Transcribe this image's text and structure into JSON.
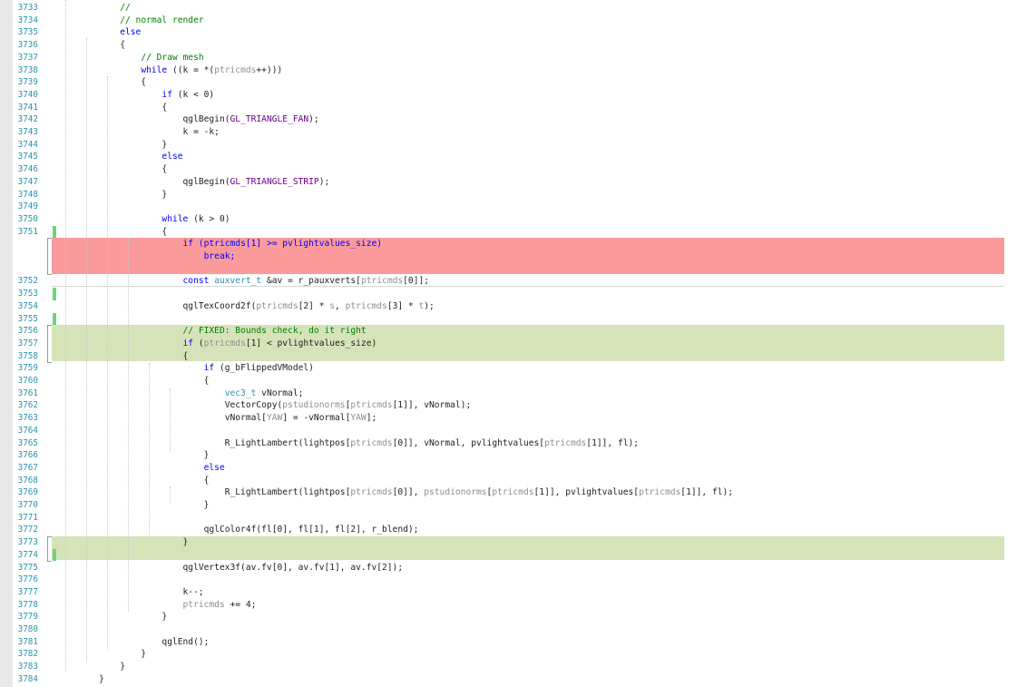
{
  "colors": {
    "line_number": "#2b91af",
    "keyword": "#0000ff",
    "comment": "#008000",
    "type": "#2b91af",
    "removed_block": "#fa9a9a",
    "added_block": "#d6e3b9",
    "change_marker": "#6bd67a"
  },
  "lines": [
    {
      "num": "3733",
      "tokens": [
        {
          "t": "        "
        },
        {
          "t": "//",
          "c": "cm"
        }
      ]
    },
    {
      "num": "3734",
      "tokens": [
        {
          "t": "        "
        },
        {
          "t": "// normal render",
          "c": "cm"
        }
      ]
    },
    {
      "num": "3735",
      "tokens": [
        {
          "t": "        "
        },
        {
          "t": "else",
          "c": "kw"
        }
      ]
    },
    {
      "num": "3736",
      "tokens": [
        {
          "t": "        {"
        }
      ]
    },
    {
      "num": "3737",
      "tokens": [
        {
          "t": "            "
        },
        {
          "t": "// Draw mesh",
          "c": "cm"
        }
      ]
    },
    {
      "num": "3738",
      "tokens": [
        {
          "t": "            "
        },
        {
          "t": "while",
          "c": "kw"
        },
        {
          "t": " ((k = *("
        },
        {
          "t": "ptricmds",
          "c": "ga"
        },
        {
          "t": "++)))"
        }
      ]
    },
    {
      "num": "3739",
      "tokens": [
        {
          "t": "            {"
        }
      ]
    },
    {
      "num": "3740",
      "tokens": [
        {
          "t": "                "
        },
        {
          "t": "if",
          "c": "kw"
        },
        {
          "t": " (k < 0)"
        }
      ]
    },
    {
      "num": "3741",
      "tokens": [
        {
          "t": "                {"
        }
      ]
    },
    {
      "num": "3742",
      "tokens": [
        {
          "t": "                    qglBegin("
        },
        {
          "t": "GL_TRIANGLE_FAN",
          "c": "mac"
        },
        {
          "t": ");"
        }
      ]
    },
    {
      "num": "3743",
      "tokens": [
        {
          "t": "                    k = -k;"
        }
      ]
    },
    {
      "num": "3744",
      "tokens": [
        {
          "t": "                }"
        }
      ]
    },
    {
      "num": "3745",
      "tokens": [
        {
          "t": "                "
        },
        {
          "t": "else",
          "c": "kw"
        }
      ]
    },
    {
      "num": "3746",
      "tokens": [
        {
          "t": "                {"
        }
      ]
    },
    {
      "num": "3747",
      "tokens": [
        {
          "t": "                    qglBegin("
        },
        {
          "t": "GL_TRIANGLE_STRIP",
          "c": "mac"
        },
        {
          "t": ");"
        }
      ]
    },
    {
      "num": "3748",
      "tokens": [
        {
          "t": "                }"
        }
      ]
    },
    {
      "num": "3749",
      "tokens": [
        {
          "t": ""
        }
      ]
    },
    {
      "num": "3750",
      "tokens": [
        {
          "t": "                "
        },
        {
          "t": "while",
          "c": "kw"
        },
        {
          "t": " (k > 0)"
        }
      ]
    },
    {
      "num": "3751",
      "tokens": [
        {
          "t": "                {"
        }
      ]
    },
    {
      "num": "",
      "tokens": [
        {
          "t": "                    "
        },
        {
          "t": "if (ptricmds[1] >= pvlightvalues_size)",
          "c": "kw"
        }
      ]
    },
    {
      "num": "",
      "tokens": [
        {
          "t": "                        "
        },
        {
          "t": "break;",
          "c": "kw"
        }
      ]
    },
    {
      "num": "",
      "tokens": [
        {
          "t": ""
        }
      ]
    },
    {
      "num": "3752",
      "tokens": [
        {
          "t": "                    "
        },
        {
          "t": "const",
          "c": "kw"
        },
        {
          "t": " "
        },
        {
          "t": "auxvert_t",
          "c": "ty"
        },
        {
          "t": " &av = r_pauxverts["
        },
        {
          "t": "ptricmds",
          "c": "ga"
        },
        {
          "t": "[0]];"
        }
      ]
    },
    {
      "num": "3753",
      "tokens": [
        {
          "t": ""
        }
      ]
    },
    {
      "num": "3754",
      "tokens": [
        {
          "t": "                    qglTexCoord2f("
        },
        {
          "t": "ptricmds",
          "c": "ga"
        },
        {
          "t": "[2] * "
        },
        {
          "t": "s",
          "c": "ga"
        },
        {
          "t": ", "
        },
        {
          "t": "ptricmds",
          "c": "ga"
        },
        {
          "t": "[3] * "
        },
        {
          "t": "t",
          "c": "ga"
        },
        {
          "t": ");"
        }
      ]
    },
    {
      "num": "3755",
      "tokens": [
        {
          "t": ""
        }
      ]
    },
    {
      "num": "3756",
      "tokens": [
        {
          "t": "                    "
        },
        {
          "t": "// FIXED: Bounds check, do it right",
          "c": "cm"
        }
      ]
    },
    {
      "num": "3757",
      "tokens": [
        {
          "t": "                    "
        },
        {
          "t": "if",
          "c": "kw"
        },
        {
          "t": " ("
        },
        {
          "t": "ptricmds",
          "c": "ga"
        },
        {
          "t": "[1] < pvlightvalues_size)"
        }
      ]
    },
    {
      "num": "3758",
      "tokens": [
        {
          "t": "                    {"
        }
      ]
    },
    {
      "num": "3759",
      "tokens": [
        {
          "t": "                        "
        },
        {
          "t": "if",
          "c": "kw"
        },
        {
          "t": " (g_bFlippedVModel)"
        }
      ]
    },
    {
      "num": "3760",
      "tokens": [
        {
          "t": "                        {"
        }
      ]
    },
    {
      "num": "3761",
      "tokens": [
        {
          "t": "                            "
        },
        {
          "t": "vec3_t",
          "c": "ty"
        },
        {
          "t": " vNormal;"
        }
      ]
    },
    {
      "num": "3762",
      "tokens": [
        {
          "t": "                            VectorCopy("
        },
        {
          "t": "pstudionorms",
          "c": "ga"
        },
        {
          "t": "["
        },
        {
          "t": "ptricmds",
          "c": "ga"
        },
        {
          "t": "[1]], vNormal);"
        }
      ]
    },
    {
      "num": "3763",
      "tokens": [
        {
          "t": "                            vNormal["
        },
        {
          "t": "YAW",
          "c": "ga"
        },
        {
          "t": "] = -vNormal["
        },
        {
          "t": "YAW",
          "c": "ga"
        },
        {
          "t": "];"
        }
      ]
    },
    {
      "num": "3764",
      "tokens": [
        {
          "t": ""
        }
      ]
    },
    {
      "num": "3765",
      "tokens": [
        {
          "t": "                            R_LightLambert(lightpos["
        },
        {
          "t": "ptricmds",
          "c": "ga"
        },
        {
          "t": "[0]], vNormal, pvlightvalues["
        },
        {
          "t": "ptricmds",
          "c": "ga"
        },
        {
          "t": "[1]], fl);"
        }
      ]
    },
    {
      "num": "3766",
      "tokens": [
        {
          "t": "                        }"
        }
      ]
    },
    {
      "num": "3767",
      "tokens": [
        {
          "t": "                        "
        },
        {
          "t": "else",
          "c": "kw"
        }
      ]
    },
    {
      "num": "3768",
      "tokens": [
        {
          "t": "                        {"
        }
      ]
    },
    {
      "num": "3769",
      "tokens": [
        {
          "t": "                            R_LightLambert(lightpos["
        },
        {
          "t": "ptricmds",
          "c": "ga"
        },
        {
          "t": "[0]], "
        },
        {
          "t": "pstudionorms",
          "c": "ga"
        },
        {
          "t": "["
        },
        {
          "t": "ptricmds",
          "c": "ga"
        },
        {
          "t": "[1]], pvlightvalues["
        },
        {
          "t": "ptricmds",
          "c": "ga"
        },
        {
          "t": "[1]], fl);"
        }
      ]
    },
    {
      "num": "3770",
      "tokens": [
        {
          "t": "                        }"
        }
      ]
    },
    {
      "num": "3771",
      "tokens": [
        {
          "t": ""
        }
      ]
    },
    {
      "num": "3772",
      "tokens": [
        {
          "t": "                        qglColor4f(fl[0], fl[1], fl[2], r_blend);"
        }
      ]
    },
    {
      "num": "3773",
      "tokens": [
        {
          "t": "                    }"
        }
      ]
    },
    {
      "num": "3774",
      "tokens": [
        {
          "t": ""
        }
      ]
    },
    {
      "num": "3775",
      "tokens": [
        {
          "t": "                    qglVertex3f(av.fv[0], av.fv[1], av.fv[2]);"
        }
      ]
    },
    {
      "num": "3776",
      "tokens": [
        {
          "t": ""
        }
      ]
    },
    {
      "num": "3777",
      "tokens": [
        {
          "t": "                    k--;"
        }
      ]
    },
    {
      "num": "3778",
      "tokens": [
        {
          "t": "                    "
        },
        {
          "t": "ptricmds",
          "c": "ga"
        },
        {
          "t": " += 4;"
        }
      ]
    },
    {
      "num": "3779",
      "tokens": [
        {
          "t": "                }"
        }
      ]
    },
    {
      "num": "3780",
      "tokens": [
        {
          "t": ""
        }
      ]
    },
    {
      "num": "3781",
      "tokens": [
        {
          "t": "                qglEnd();"
        }
      ]
    },
    {
      "num": "3782",
      "tokens": [
        {
          "t": "            }"
        }
      ]
    },
    {
      "num": "3783",
      "tokens": [
        {
          "t": "        }"
        }
      ]
    },
    {
      "num": "3784",
      "tokens": [
        {
          "t": "    }"
        }
      ]
    }
  ]
}
